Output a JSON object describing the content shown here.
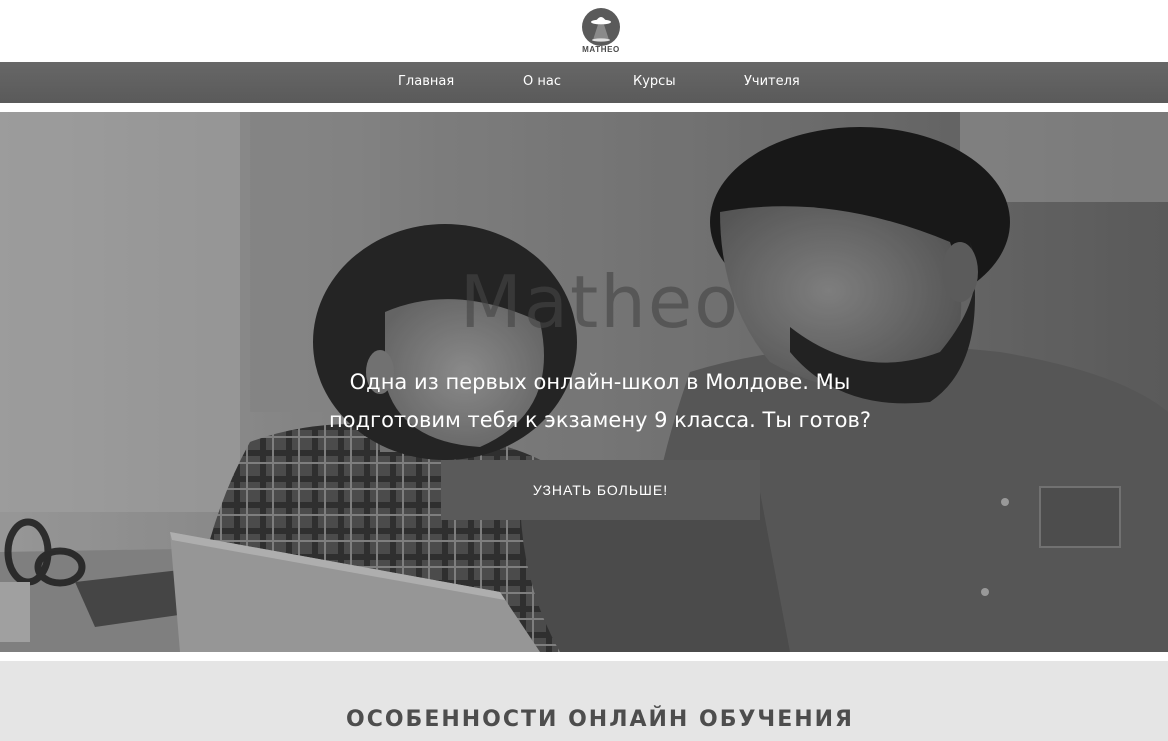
{
  "brand": {
    "logo_text": "MATHEO",
    "logo_icon": "ufo-icon"
  },
  "nav": {
    "items": [
      {
        "label": "Главная"
      },
      {
        "label": "О нас"
      },
      {
        "label": "Курсы"
      },
      {
        "label": "Учителя"
      }
    ]
  },
  "hero": {
    "title": "Matheo",
    "subtitle": "Одна из первых онлайн-школ в Молдове. Мы подготовим тебя к экзамену 9 класса. Ты готов?",
    "cta_label": "УЗНАТЬ БОЛЬШЕ!",
    "image": "father-and-son-with-tablet-photo"
  },
  "features": {
    "heading": "ОСОБЕННОСТИ ОНЛАЙН ОБУЧЕНИЯ"
  },
  "colors": {
    "nav_bg": "#5e5e5e",
    "button_bg": "#5a5a5a",
    "section_bg": "#e5e5e5",
    "heading_text": "#4d4d4d"
  }
}
